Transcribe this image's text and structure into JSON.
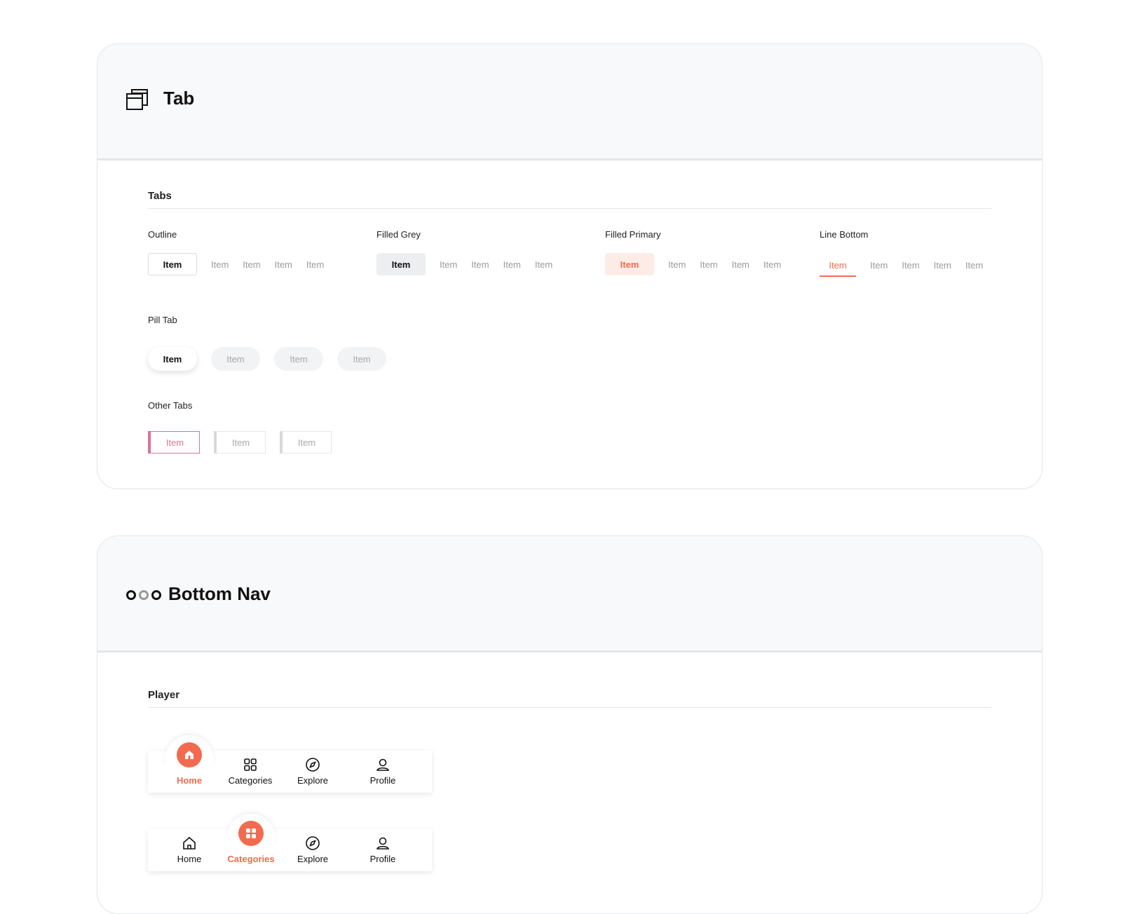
{
  "tab_card": {
    "title": "Tab",
    "icon": "browser-windows-icon",
    "section_title": "Tabs",
    "outline": {
      "label": "Outline",
      "items": [
        "Item",
        "Item",
        "Item",
        "Item",
        "Item"
      ]
    },
    "filled_grey": {
      "label": "Filled Grey",
      "items": [
        "Item",
        "Item",
        "Item",
        "Item",
        "Item"
      ]
    },
    "filled_primary": {
      "label": "Filled Primary",
      "items": [
        "Item",
        "Item",
        "Item",
        "Item",
        "Item"
      ]
    },
    "line_bottom": {
      "label": "Line Bottom",
      "items": [
        "Item",
        "Item",
        "Item",
        "Item",
        "Item"
      ]
    },
    "pill": {
      "label": "Pill Tab",
      "items": [
        "Item",
        "Item",
        "Item",
        "Item"
      ]
    },
    "other": {
      "label": "Other Tabs",
      "items": [
        "Item",
        "Item",
        "Item"
      ]
    }
  },
  "nav_card": {
    "title": "Bottom Nav",
    "icon": "dots-icon",
    "section_title": "Player",
    "nav1": {
      "active": "Home",
      "items": [
        "Home",
        "Categories",
        "Explore",
        "Profile"
      ]
    },
    "nav2": {
      "active": "Categories",
      "items": [
        "Home",
        "Categories",
        "Explore",
        "Profile"
      ]
    }
  },
  "colors": {
    "primary": "#f26b4e",
    "pink": "#d9739b",
    "header_bg": "#f8f9fa"
  }
}
